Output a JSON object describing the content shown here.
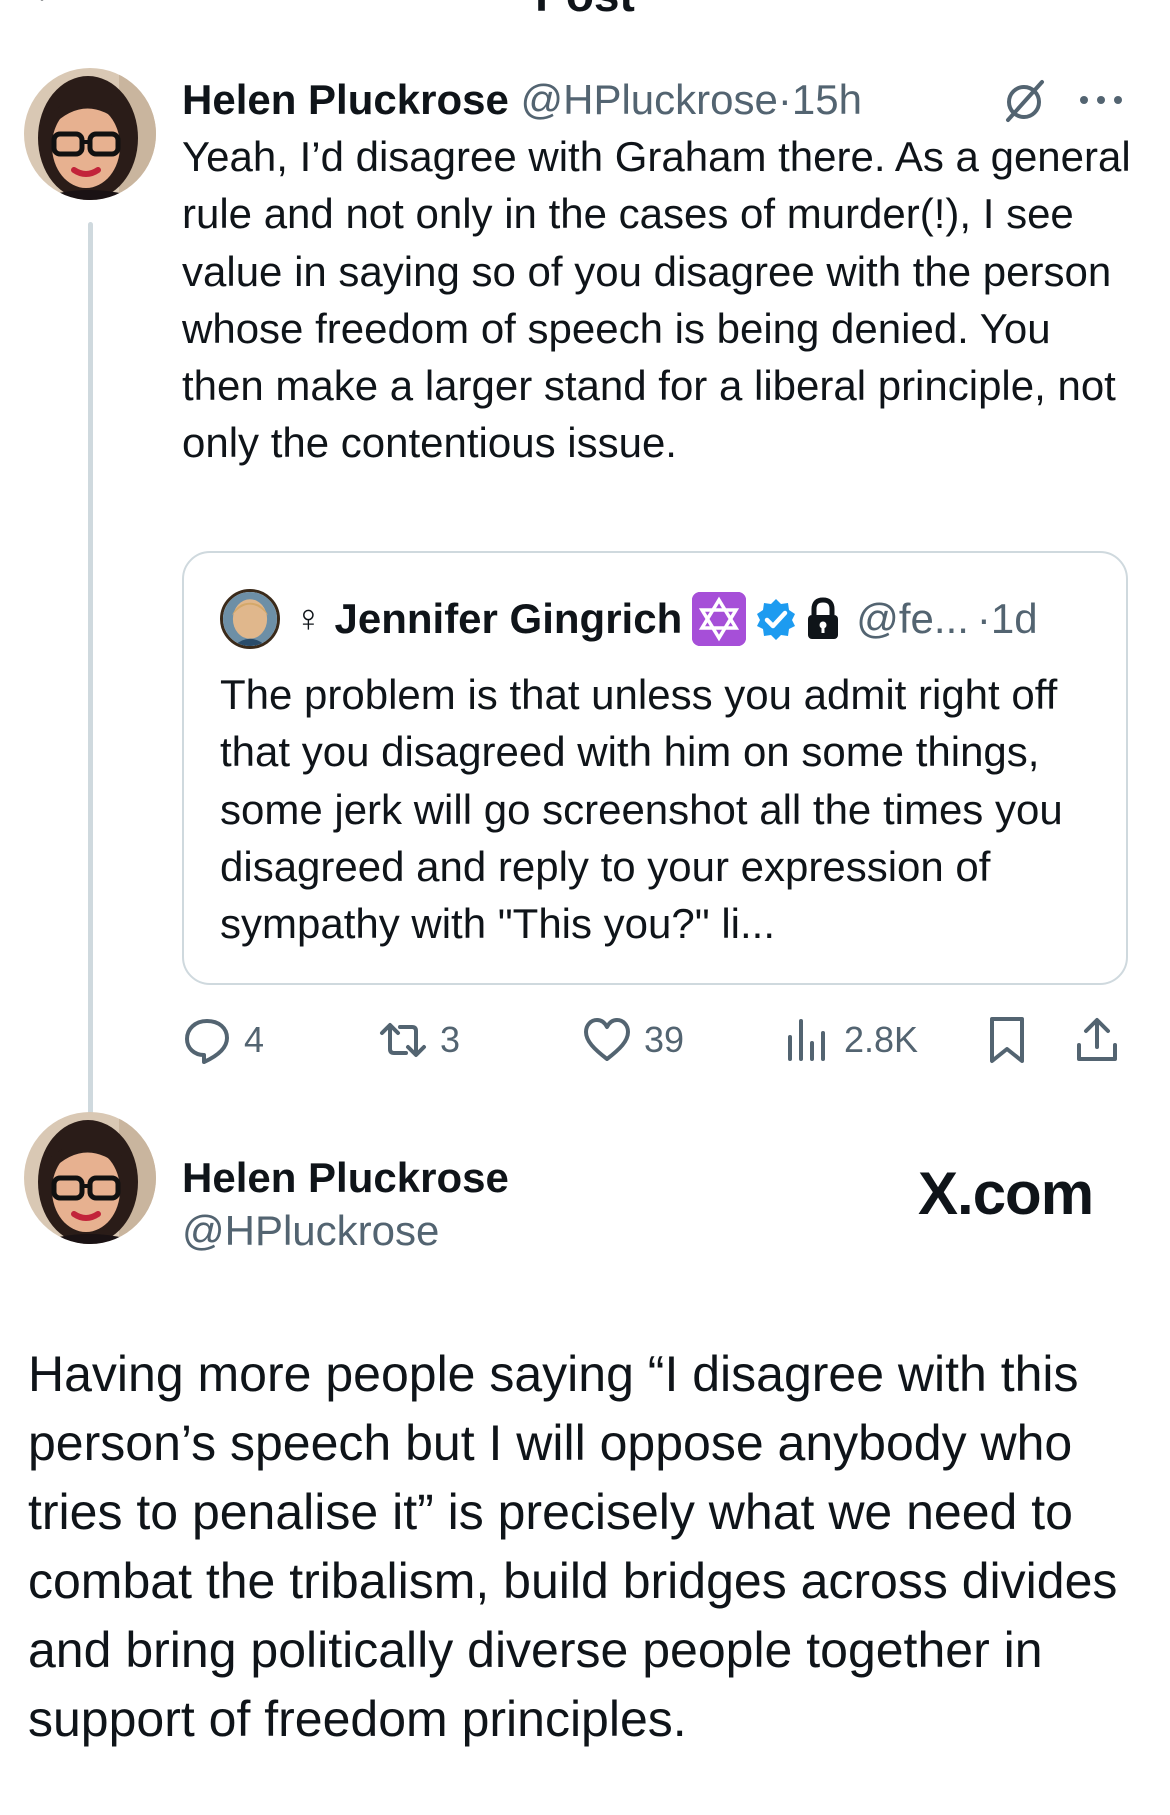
{
  "header": {
    "title": "Post"
  },
  "tweet": {
    "author_name": "Helen Pluckrose",
    "author_handle": "@HPluckrose",
    "separator": "·",
    "time": "15h",
    "text": "Yeah, I’d disagree with Graham there. As a general rule and not only in the cases of murder(!), I see value in saying so of you disagree with the person whose freedom of speech is being denied. You then make a larger stand for a liberal principle, not only the contentious issue.",
    "quote": {
      "symbol": "♀",
      "author_name": "Jennifer Gingrich",
      "handle": "@fe...",
      "separator": "·",
      "time": "1d",
      "text": "The problem is that unless you admit right off that you disagreed with him on some things, some jerk will go screenshot all the times you disagreed and reply to your expression of sympathy with \"This you?\" li..."
    },
    "actions": {
      "replies": "4",
      "reposts": "3",
      "likes": "39",
      "views": "2.8K"
    }
  },
  "card": {
    "author_name": "Helen Pluckrose",
    "author_handle": "@HPluckrose",
    "brand": "X.com",
    "text": "Having more people saying “I disagree with this person’s speech but I will oppose anybody who tries to penalise it” is precisely what we need to combat the tribalism, build bridges across divides and bring politically diverse people together in support of freedom principles."
  },
  "colors": {
    "text_primary": "#0f1419",
    "text_secondary": "#536471",
    "border": "#cfd9de",
    "verified_blue": "#1d9bf0",
    "badge_purple": "#a64fd8"
  }
}
